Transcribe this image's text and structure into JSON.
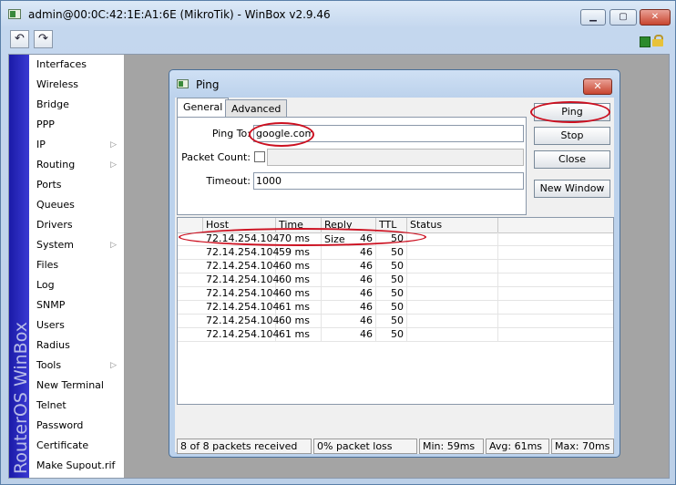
{
  "window": {
    "title": "admin@00:0C:42:1E:A1:6E (MikroTik) - WinBox v2.9.46",
    "controls": {
      "minimize": "▁",
      "maximize": "▢",
      "close": "✕"
    }
  },
  "toolbar": {
    "undo_icon": "↶",
    "redo_icon": "↷",
    "status_color": "#2c8a2c"
  },
  "brand_band": {
    "text": "RouterOS WinBox",
    "color": "#2828b8"
  },
  "sidebar": {
    "items": [
      {
        "label": "Interfaces",
        "submenu": false
      },
      {
        "label": "Wireless",
        "submenu": false
      },
      {
        "label": "Bridge",
        "submenu": false
      },
      {
        "label": "PPP",
        "submenu": false
      },
      {
        "label": "IP",
        "submenu": true
      },
      {
        "label": "Routing",
        "submenu": true
      },
      {
        "label": "Ports",
        "submenu": false
      },
      {
        "label": "Queues",
        "submenu": false
      },
      {
        "label": "Drivers",
        "submenu": false
      },
      {
        "label": "System",
        "submenu": true
      },
      {
        "label": "Files",
        "submenu": false
      },
      {
        "label": "Log",
        "submenu": false
      },
      {
        "label": "SNMP",
        "submenu": false
      },
      {
        "label": "Users",
        "submenu": false
      },
      {
        "label": "Radius",
        "submenu": false
      },
      {
        "label": "Tools",
        "submenu": true
      },
      {
        "label": "New Terminal",
        "submenu": false
      },
      {
        "label": "Telnet",
        "submenu": false
      },
      {
        "label": "Password",
        "submenu": false
      },
      {
        "label": "Certificate",
        "submenu": false
      },
      {
        "label": "Make Supout.rif",
        "submenu": false
      }
    ]
  },
  "ping_window": {
    "title": "Ping",
    "close_label": "✕",
    "tabs": [
      {
        "label": "General"
      },
      {
        "label": "Advanced"
      }
    ],
    "form": {
      "ping_to_label": "Ping To:",
      "ping_to_value": "google.com",
      "packet_count_label": "Packet Count:",
      "packet_count_value": "",
      "timeout_label": "Timeout:",
      "timeout_value": "1000"
    },
    "buttons": {
      "ping": "Ping",
      "stop": "Stop",
      "close": "Close",
      "new_window": "New Window"
    },
    "table": {
      "columns": [
        "Host",
        "Time",
        "Reply Size",
        "TTL",
        "Status"
      ],
      "rows": [
        {
          "host": "72.14.254.104",
          "time": "70 ms",
          "size": "46",
          "ttl": "50",
          "status": ""
        },
        {
          "host": "72.14.254.104",
          "time": "59 ms",
          "size": "46",
          "ttl": "50",
          "status": ""
        },
        {
          "host": "72.14.254.104",
          "time": "60 ms",
          "size": "46",
          "ttl": "50",
          "status": ""
        },
        {
          "host": "72.14.254.104",
          "time": "60 ms",
          "size": "46",
          "ttl": "50",
          "status": ""
        },
        {
          "host": "72.14.254.104",
          "time": "60 ms",
          "size": "46",
          "ttl": "50",
          "status": ""
        },
        {
          "host": "72.14.254.104",
          "time": "61 ms",
          "size": "46",
          "ttl": "50",
          "status": ""
        },
        {
          "host": "72.14.254.104",
          "time": "60 ms",
          "size": "46",
          "ttl": "50",
          "status": ""
        },
        {
          "host": "72.14.254.104",
          "time": "61 ms",
          "size": "46",
          "ttl": "50",
          "status": ""
        }
      ]
    },
    "status": {
      "received": "8 of 8 packets received",
      "loss": "0% packet loss",
      "min": "Min: 59ms",
      "avg": "Avg: 61ms",
      "max": "Max: 70ms"
    },
    "highlight_color": "#cc1020"
  }
}
